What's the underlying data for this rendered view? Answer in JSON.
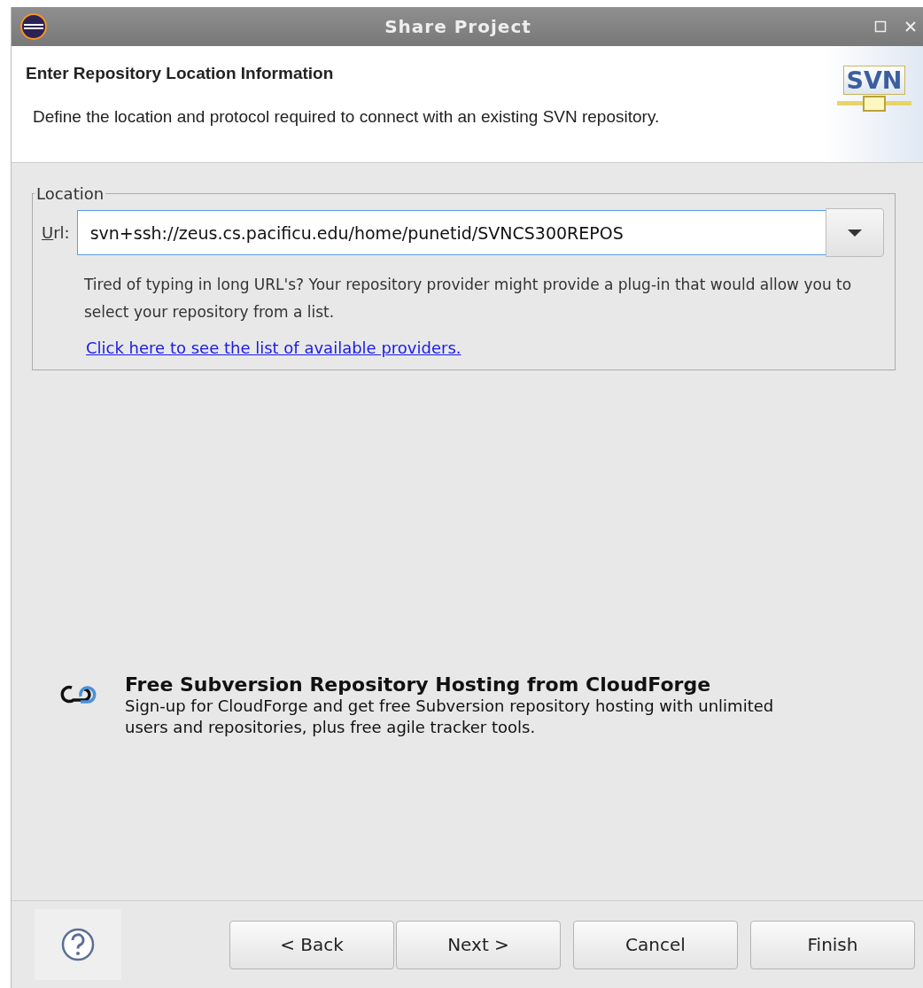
{
  "window": {
    "title": "Share Project"
  },
  "header": {
    "title": "Enter Repository Location Information",
    "description": "Define the location and protocol required to connect with an existing SVN repository.",
    "logo_text": "SVN"
  },
  "location": {
    "legend": "Location",
    "url_label": "Url:",
    "url_value": "svn+ssh://zeus.cs.pacificu.edu/home/punetid/SVNCS300REPOS",
    "hint": "Tired of typing in long URL's?  Your repository provider might provide a plug-in that would allow you to select your repository from a list.",
    "link": "Click here to see the list of available providers."
  },
  "promo": {
    "title": "Free Subversion Repository Hosting from CloudForge",
    "text": "Sign-up for CloudForge and get free Subversion repository hosting with unlimited users and repositories, plus free agile tracker tools."
  },
  "buttons": [
    {
      "label": "< Back",
      "disabled": false
    },
    {
      "label": "Next >",
      "disabled": false
    },
    {
      "label": "Cancel",
      "disabled": false
    },
    {
      "label": "Finish",
      "disabled": false
    }
  ]
}
